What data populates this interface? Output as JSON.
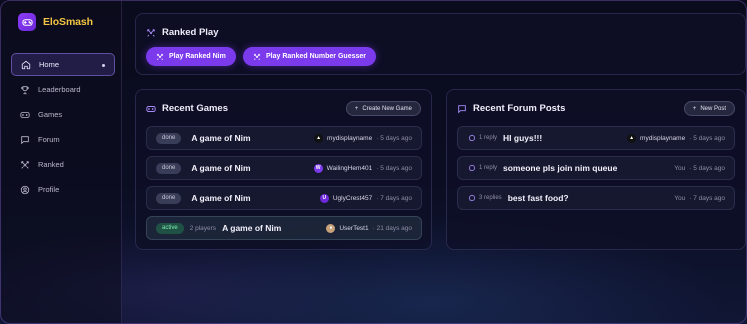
{
  "brand": {
    "name": "EloSmash"
  },
  "sidebar": {
    "items": [
      {
        "label": "Home",
        "icon": "home-icon",
        "active": true
      },
      {
        "label": "Leaderboard",
        "icon": "trophy-icon"
      },
      {
        "label": "Games",
        "icon": "gamepad-icon"
      },
      {
        "label": "Forum",
        "icon": "message-square-icon"
      },
      {
        "label": "Ranked",
        "icon": "swords-icon"
      },
      {
        "label": "Profile",
        "icon": "user-circle-icon"
      }
    ]
  },
  "ranked": {
    "title": "Ranked Play",
    "buttons": [
      "Play Ranked Nim",
      "Play Ranked Number Guesser"
    ]
  },
  "games": {
    "title": "Recent Games",
    "create_label": "Create New Game",
    "rows": [
      {
        "status": "done",
        "title": "A game of Nim",
        "user": "mydisplayname",
        "time": "· 5 days ago"
      },
      {
        "status": "done",
        "title": "A game of Nim",
        "user": "WailingHem401",
        "time": "· 5 days ago"
      },
      {
        "status": "done",
        "title": "A game of Nim",
        "user": "UglyCrest457",
        "time": "· 7 days ago"
      },
      {
        "status": "active",
        "players": "2 players",
        "title": "A game of Nim",
        "user": "UserTest1",
        "time": "· 21 days ago"
      }
    ]
  },
  "forum": {
    "title": "Recent Forum Posts",
    "new_label": "New Post",
    "rows": [
      {
        "replies": "1 reply",
        "title": "HI guys!!!",
        "user": "mydisplayname",
        "time": "· 5 days ago"
      },
      {
        "replies": "1 reply",
        "title": "someone pls join nim queue",
        "user": "You",
        "time": "· 5 days ago"
      },
      {
        "replies": "3 replies",
        "title": "best fast food?",
        "user": "You",
        "time": "· 7 days ago"
      }
    ]
  },
  "colors": {
    "accent": "#7c3aed",
    "brand": "#f4c542",
    "active_badge": "#7ff0b0"
  }
}
